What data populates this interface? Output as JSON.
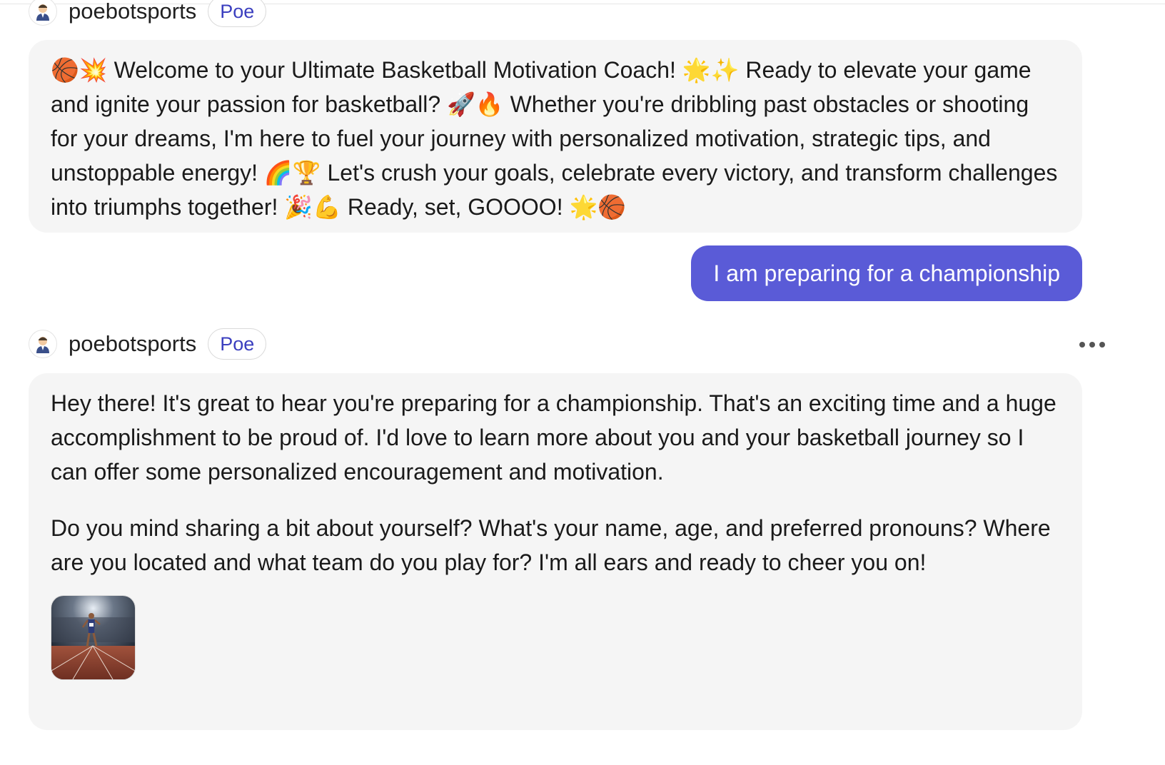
{
  "messages": [
    {
      "sender": "poebotsports",
      "badge": "Poe",
      "text": "🏀💥 Welcome to your Ultimate Basketball Motivation Coach! 🌟✨ Ready to elevate your game and ignite your passion for basketball? 🚀🔥 Whether you're dribbling past obstacles or shooting for your dreams, I'm here to fuel your journey with personalized motivation, strategic tips, and unstoppable energy! 🌈🏆 Let's crush your goals, celebrate every victory, and transform challenges into triumphs together! 🎉💪 Ready, set, GOOOO! 🌟🏀"
    },
    {
      "sender": "user",
      "text": "I am preparing for a championship"
    },
    {
      "sender": "poebotsports",
      "badge": "Poe",
      "paragraphs": [
        "Hey there! It's great to hear you're preparing for a championship. That's an exciting time and a huge accomplishment to be proud of. I'd love to learn more about you and your basketball journey so I can offer some personalized encouragement and motivation.",
        "Do you mind sharing a bit about yourself? What's your name, age, and preferred pronouns? Where are you located and what team do you play for? I'm all ears and ready to cheer you on!"
      ]
    }
  ],
  "colors": {
    "user_bubble": "#5a5bd7",
    "bot_bubble": "#f5f5f5",
    "badge_text": "#3b3fbf"
  },
  "icons": {
    "avatar": "bot-avatar-icon",
    "more": "more-options-icon",
    "image": "runner-stadium-thumbnail"
  }
}
